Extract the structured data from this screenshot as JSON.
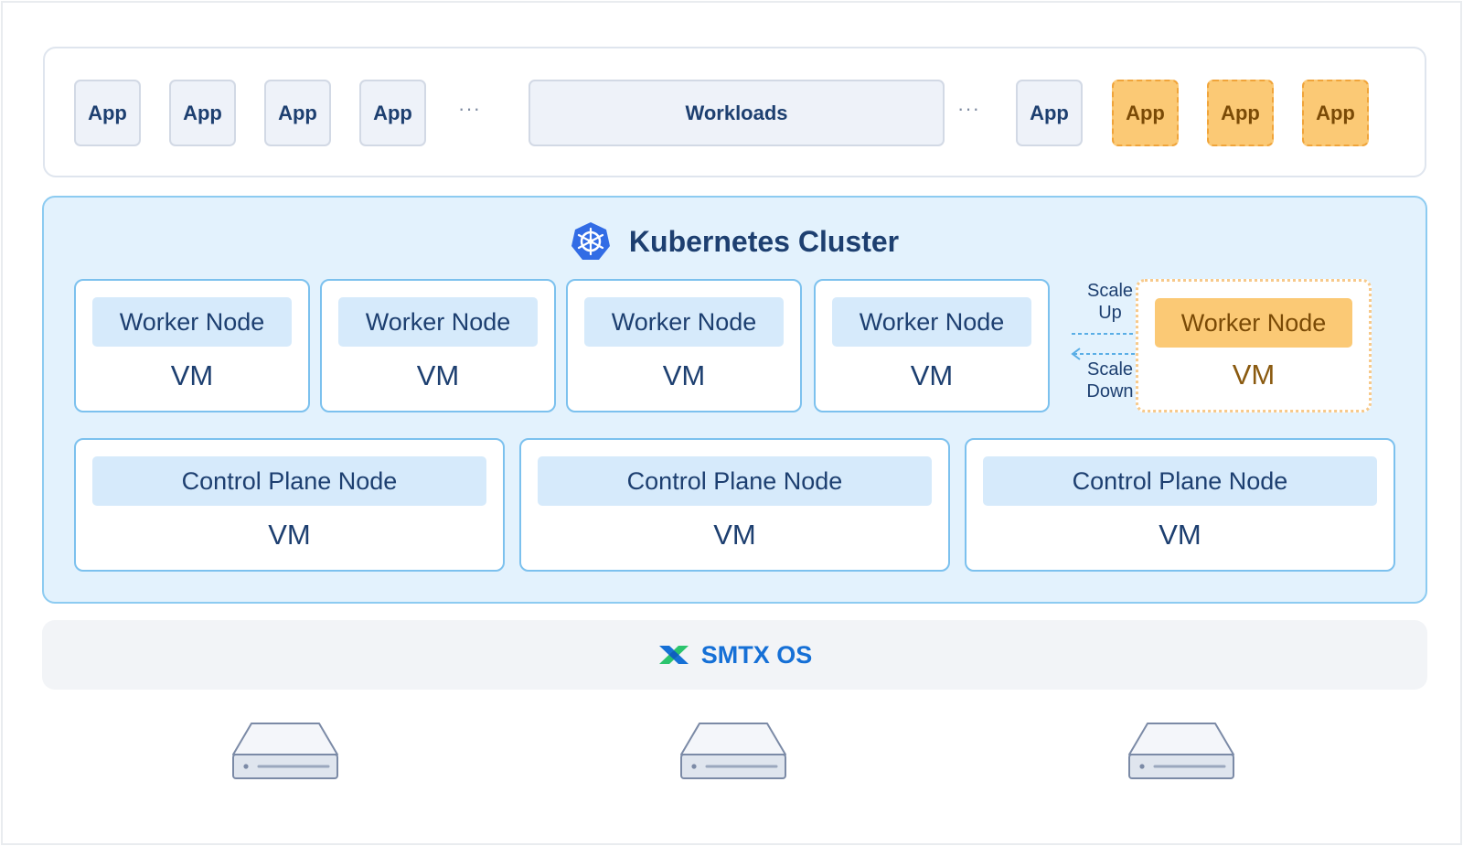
{
  "workloads": {
    "apps_left": [
      "App",
      "App",
      "App",
      "App"
    ],
    "ellipsis": "···",
    "center_label": "Workloads",
    "apps_right": [
      "App"
    ],
    "apps_pending": [
      "App",
      "App",
      "App"
    ]
  },
  "cluster": {
    "title": "Kubernetes Cluster",
    "icon": "kubernetes-icon",
    "worker_nodes": [
      {
        "label": "Worker Node",
        "vm": "VM"
      },
      {
        "label": "Worker Node",
        "vm": "VM"
      },
      {
        "label": "Worker Node",
        "vm": "VM"
      },
      {
        "label": "Worker Node",
        "vm": "VM"
      }
    ],
    "pending_worker": {
      "label": "Worker Node",
      "vm": "VM"
    },
    "scale_up": [
      "Scale",
      "Up"
    ],
    "scale_down": [
      "Scale",
      "Down"
    ],
    "control_nodes": [
      {
        "label": "Control Plane Node",
        "vm": "VM"
      },
      {
        "label": "Control Plane Node",
        "vm": "VM"
      },
      {
        "label": "Control Plane Node",
        "vm": "VM"
      }
    ]
  },
  "os": {
    "name": "SMTX OS",
    "icon": "smtx-logo-icon"
  },
  "servers": [
    "server-icon",
    "server-icon",
    "server-icon"
  ],
  "colors": {
    "primary_text": "#1d3f70",
    "cluster_bg": "#e3f2fd",
    "node_border": "#7cc1ee",
    "pending": "#fbc975",
    "os_brand": "#1670d6"
  }
}
